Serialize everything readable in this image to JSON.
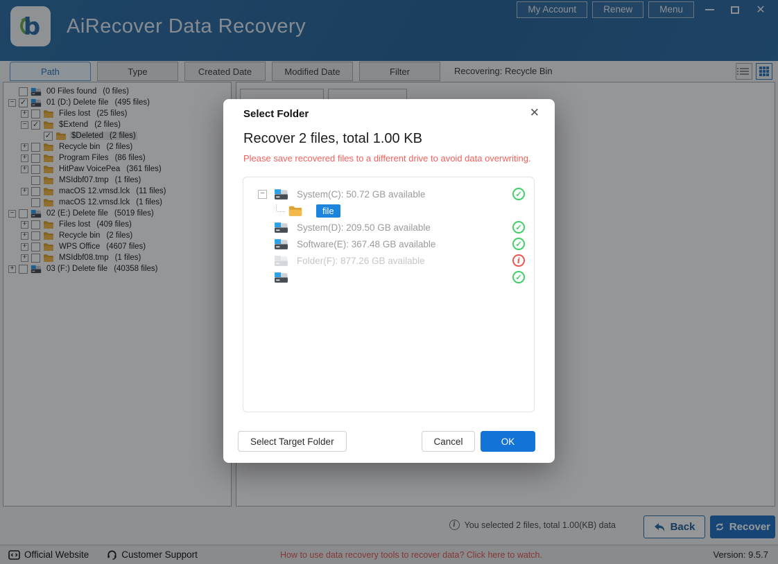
{
  "colors": {
    "accent": "#2e6da4",
    "ok_green": "#41cf63",
    "error_red": "#f05552",
    "warning_red": "#f2605a",
    "chip_blue": "#1b84dc",
    "recover_blue": "#2173c2",
    "ok_button_blue": "#1473d6"
  },
  "header": {
    "title": "AiRecover Data Recovery",
    "logo_icon": "airecover-b-logo",
    "buttons": [
      {
        "label": "My Account"
      },
      {
        "label": "Renew"
      },
      {
        "label": "Menu"
      }
    ],
    "window_controls": [
      "minimize",
      "maximize",
      "close"
    ]
  },
  "tabbar": {
    "tabs": [
      {
        "label": "Path",
        "active": true
      },
      {
        "label": "Type",
        "active": false
      },
      {
        "label": "Created Date",
        "active": false
      },
      {
        "label": "Modified Date",
        "active": false
      },
      {
        "label": "Filter",
        "active": false
      }
    ],
    "status": "Recovering: Recycle Bin",
    "view_toggles": [
      {
        "icon": "list-view-icon",
        "active": false
      },
      {
        "icon": "grid-view-icon",
        "active": true
      }
    ]
  },
  "tree": {
    "items": [
      {
        "level": 0,
        "exp": "",
        "check": false,
        "icon": "drive",
        "name": "00 Files found",
        "count": "(0 files)"
      },
      {
        "level": 0,
        "exp": "-",
        "check": true,
        "icon": "drive",
        "name": "01 (D:) Delete file",
        "count": "(495 files)"
      },
      {
        "level": 1,
        "exp": "+",
        "check": false,
        "icon": "folder",
        "name": "Files lost",
        "count": "(25 files)"
      },
      {
        "level": 1,
        "exp": "-",
        "check": true,
        "icon": "folder",
        "name": "$Extend",
        "count": "(2 files)"
      },
      {
        "level": 2,
        "exp": "",
        "check": true,
        "icon": "folder",
        "name": "$Deleted",
        "count": "(2 files)",
        "selected": true
      },
      {
        "level": 1,
        "exp": "+",
        "check": false,
        "icon": "folder",
        "name": "Recycle bin",
        "count": "(2 files)"
      },
      {
        "level": 1,
        "exp": "+",
        "check": false,
        "icon": "folder",
        "name": "Program Files",
        "count": "(86 files)"
      },
      {
        "level": 1,
        "exp": "+",
        "check": false,
        "icon": "folder",
        "name": "HitPaw VoicePea",
        "count": "(361 files)"
      },
      {
        "level": 1,
        "exp": "",
        "check": false,
        "icon": "folder",
        "name": "MSIdbf07.tmp",
        "count": "(1 files)"
      },
      {
        "level": 1,
        "exp": "+",
        "check": false,
        "icon": "folder",
        "name": "macOS 12.vmsd.lck",
        "count": "(11 files)"
      },
      {
        "level": 1,
        "exp": "",
        "check": false,
        "icon": "folder",
        "name": "macOS 12.vmsd.lck",
        "count": "(1 files)"
      },
      {
        "level": 0,
        "exp": "-",
        "check": false,
        "icon": "drive",
        "name": "02 (E:) Delete file",
        "count": "(5019 files)"
      },
      {
        "level": 1,
        "exp": "+",
        "check": false,
        "icon": "folder",
        "name": "Files lost",
        "count": "(409 files)"
      },
      {
        "level": 1,
        "exp": "+",
        "check": false,
        "icon": "folder",
        "name": "Recycle bin",
        "count": "(2 files)"
      },
      {
        "level": 1,
        "exp": "+",
        "check": false,
        "icon": "folder",
        "name": "WPS Office",
        "count": "(4607 files)"
      },
      {
        "level": 1,
        "exp": "+",
        "check": false,
        "icon": "folder",
        "name": "MSIdbf08.tmp",
        "count": "(1 files)"
      },
      {
        "level": 0,
        "exp": "+",
        "check": false,
        "icon": "drive",
        "name": "03 (F:) Delete file",
        "count": "(40358 files)"
      }
    ]
  },
  "dialog": {
    "title": "Select Folder",
    "close_icon": "close-icon",
    "heading": "Recover 2 files, total 1.00 KB",
    "warning": "Please save recovered files to a different drive to avoid data overwriting.",
    "drives": [
      {
        "exp": "-",
        "icon": "drive",
        "label": "System(C): 50.72 GB available",
        "status": "ok",
        "disabled": false
      },
      {
        "child": true,
        "icon": "folder",
        "label": "file",
        "chip": true
      },
      {
        "exp": "",
        "icon": "drive",
        "label": "System(D): 209.50 GB available",
        "status": "ok",
        "disabled": false
      },
      {
        "exp": "",
        "icon": "drive",
        "label": "Software(E): 367.48 GB available",
        "status": "ok",
        "disabled": false
      },
      {
        "exp": "",
        "icon": "drive-disabled",
        "label": "Folder(F): 877.26 GB available",
        "status": "error",
        "disabled": true
      },
      {
        "exp": "",
        "icon": "drive",
        "label": "",
        "status": "ok",
        "disabled": false
      }
    ],
    "buttons": {
      "select_target": "Select Target Folder",
      "cancel": "Cancel",
      "ok": "OK"
    }
  },
  "bottombar": {
    "info_icon": "info-icon",
    "info": "You selected 2 files, total 1.00(KB) data",
    "back": "Back",
    "recover": "Recover"
  },
  "footer": {
    "official_site": "Official Website",
    "support": "Customer Support",
    "help": "How to use data recovery tools to recover data? Click here to watch.",
    "version": "Version: 9.5.7"
  }
}
